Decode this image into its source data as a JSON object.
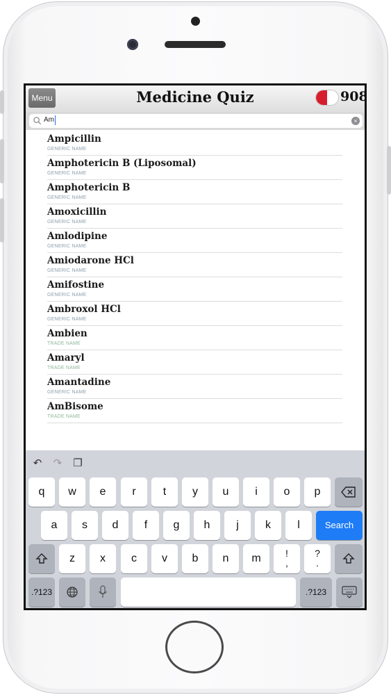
{
  "header": {
    "menu_label": "Menu",
    "title": "Medicine Quiz",
    "score": "908"
  },
  "search": {
    "value": "Am"
  },
  "items": [
    {
      "name": "Ampicillin",
      "type": "GENERIC NAME"
    },
    {
      "name": "Amphotericin B (Liposomal)",
      "type": "GENERIC NAME"
    },
    {
      "name": "Amphotericin B",
      "type": "GENERIC NAME"
    },
    {
      "name": "Amoxicillin",
      "type": "GENERIC NAME"
    },
    {
      "name": "Amlodipine",
      "type": "GENERIC NAME"
    },
    {
      "name": "Amiodarone HCl",
      "type": "GENERIC NAME"
    },
    {
      "name": "Amifostine",
      "type": "GENERIC NAME"
    },
    {
      "name": "Ambroxol HCl",
      "type": "GENERIC NAME"
    },
    {
      "name": "Ambien",
      "type": "TRADE NAME"
    },
    {
      "name": "Amaryl",
      "type": "TRADE NAME"
    },
    {
      "name": "Amantadine",
      "type": "GENERIC NAME"
    },
    {
      "name": "AmBisome",
      "type": "TRADE NAME"
    }
  ],
  "keyboard": {
    "row1": [
      "q",
      "w",
      "e",
      "r",
      "t",
      "y",
      "u",
      "i",
      "o",
      "p"
    ],
    "row2": [
      "a",
      "s",
      "d",
      "f",
      "g",
      "h",
      "j",
      "k",
      "l"
    ],
    "row3": [
      "z",
      "x",
      "c",
      "v",
      "b",
      "n",
      "m"
    ],
    "punct1": [
      "!",
      ","
    ],
    "punct2": [
      "?",
      "."
    ],
    "search_label": "Search",
    "numbers_label": ".?123"
  },
  "icons": {
    "undo": "undo-icon",
    "redo": "redo-icon",
    "paste": "paste-icon",
    "shift": "shift-icon",
    "backspace": "backspace-icon",
    "globe": "globe-icon",
    "mic": "microphone-icon",
    "hide_keyboard": "hide-keyboard-icon",
    "search": "search-icon",
    "clear": "clear-icon"
  },
  "colors": {
    "score_pill_red": "#d51f2d",
    "search_key": "#1e7cf6",
    "generic_label": "#8fa0ad",
    "trade_label": "#8fb89a"
  }
}
